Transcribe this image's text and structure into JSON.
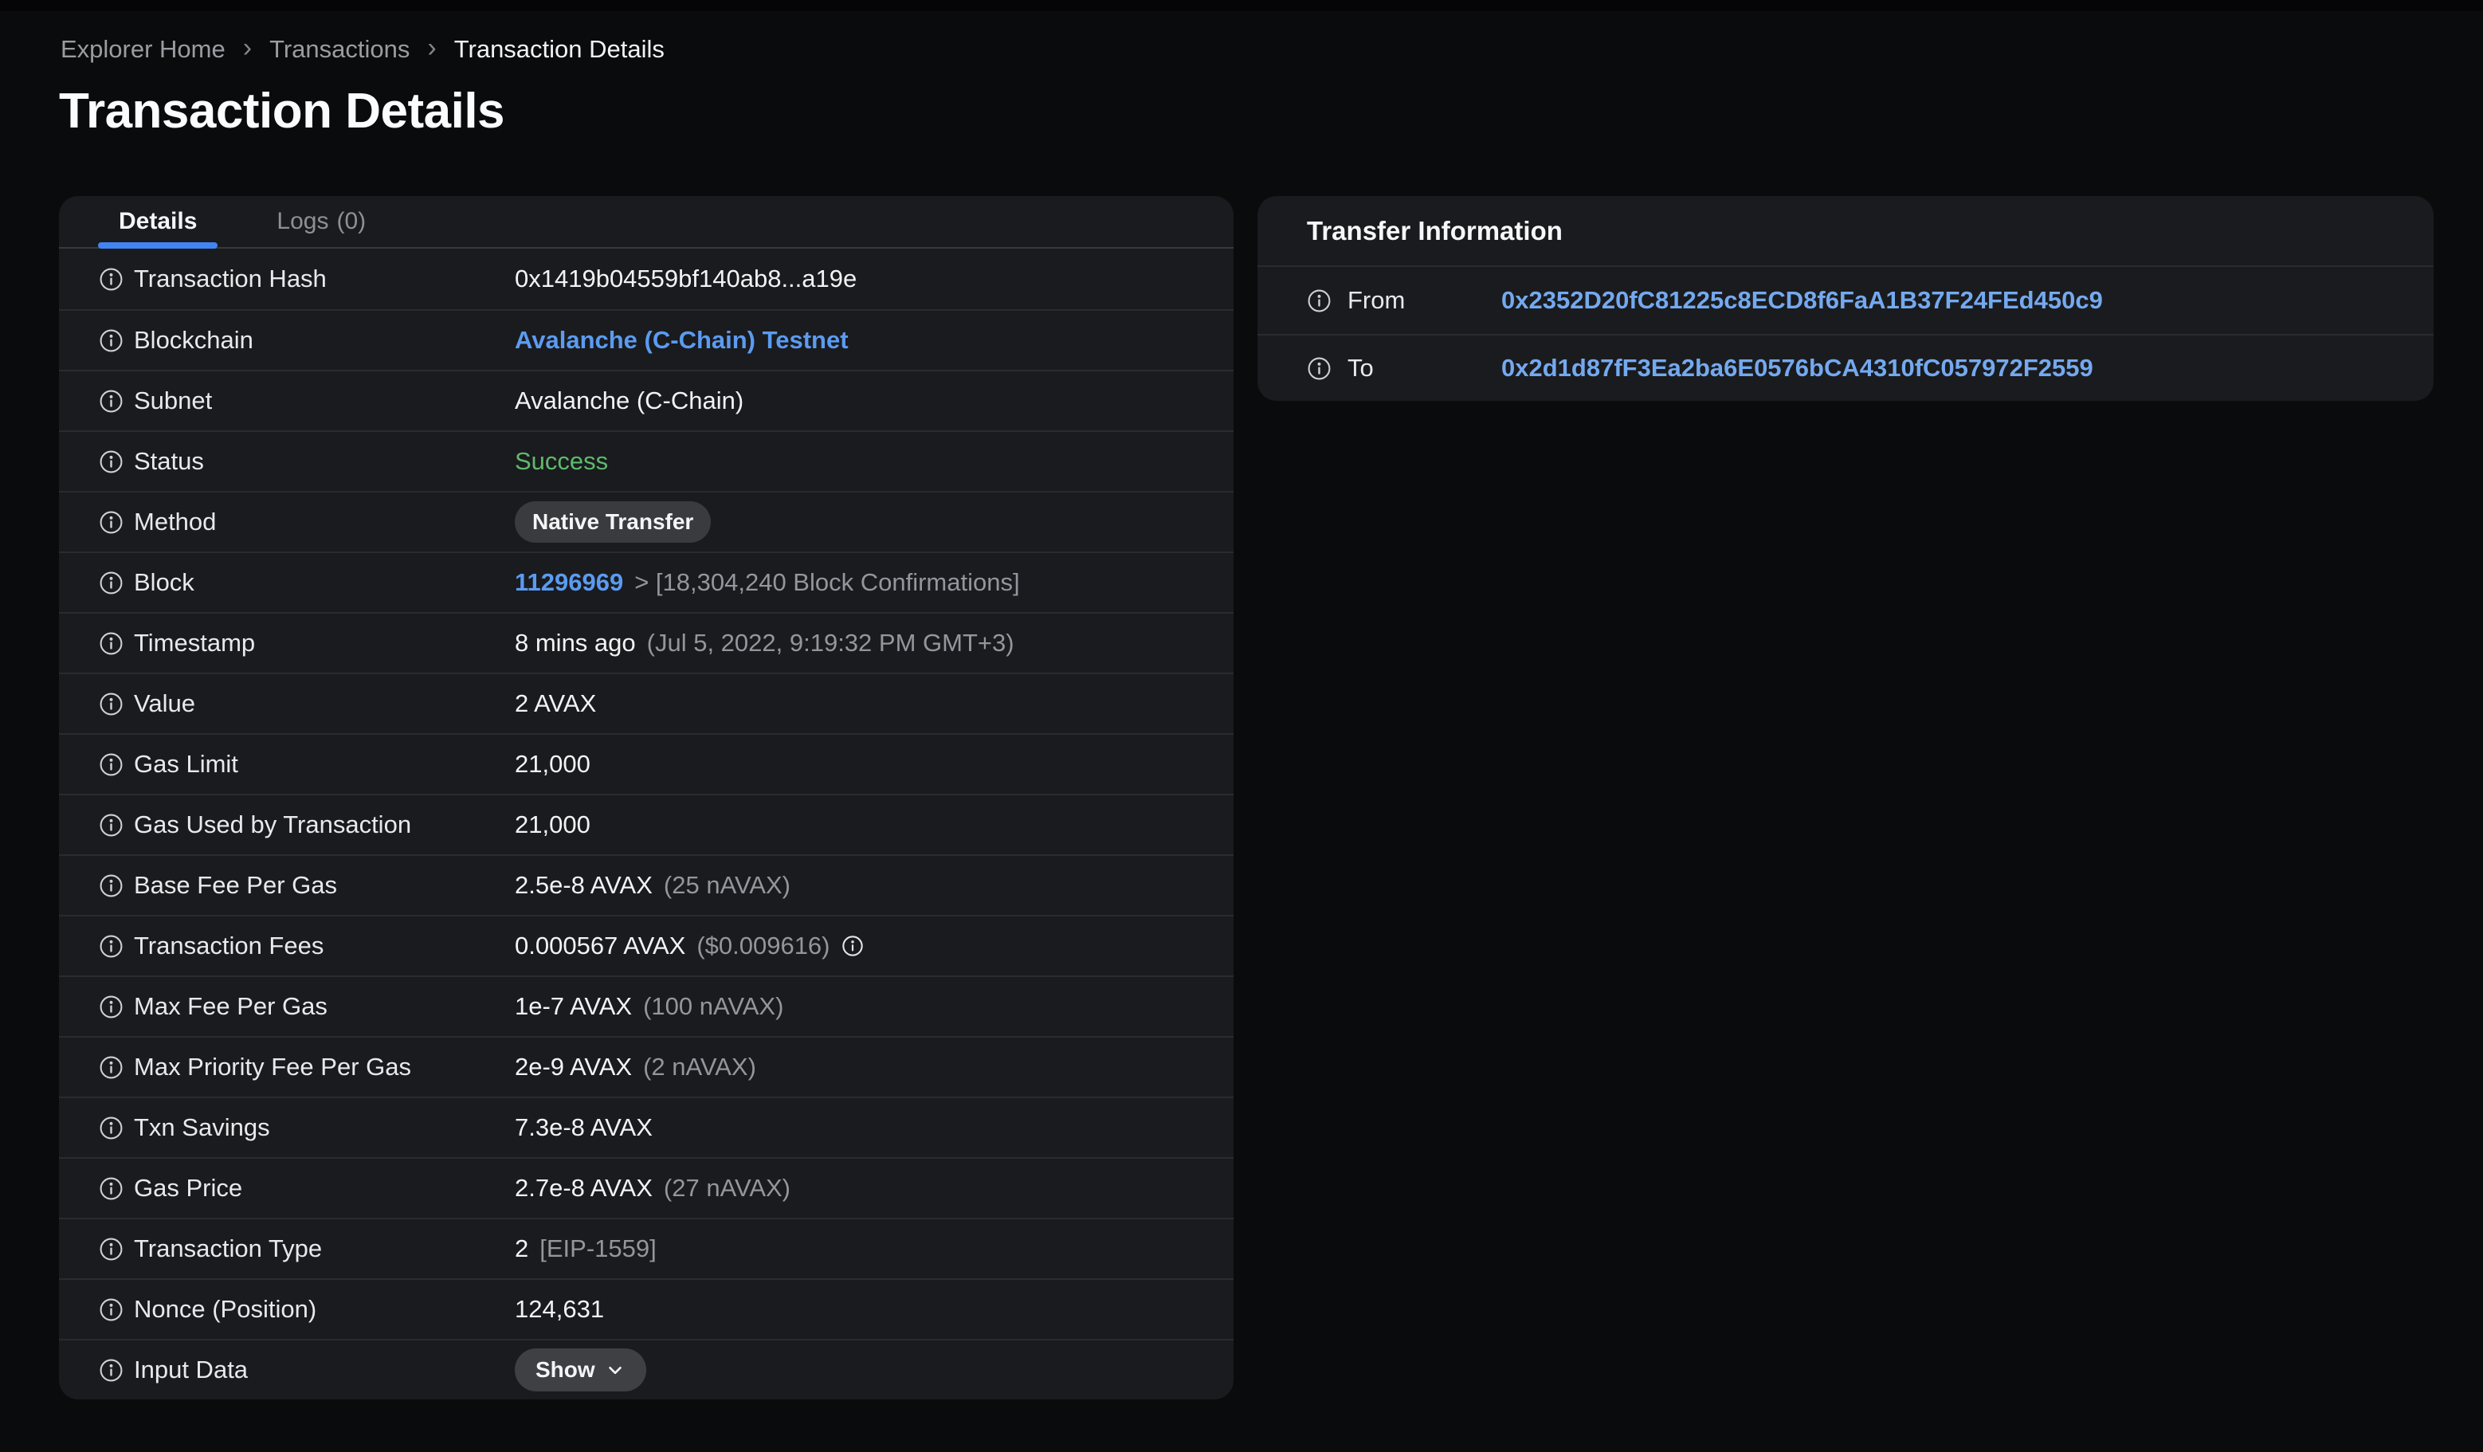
{
  "colors": {
    "accent_blue": "#4285f2",
    "link_blue": "#5b9bf1",
    "address_blue": "#74a9ef",
    "success_green": "#5fba6c",
    "card_background": "#1a1b1e",
    "page_background": "#0a0b0d"
  },
  "breadcrumb": {
    "separator": "›",
    "items": [
      {
        "label": "Explorer Home"
      },
      {
        "label": "Transactions"
      },
      {
        "label": "Transaction Details"
      }
    ]
  },
  "page": {
    "title": "Transaction Details"
  },
  "details_card": {
    "tabs": [
      {
        "label": "Details"
      },
      {
        "label": "Logs",
        "count": "(0)"
      }
    ],
    "rows": [
      {
        "label": "Transaction Hash",
        "main": "0x1419b04559bf140ab8...a19e"
      },
      {
        "label": "Blockchain",
        "link": "Avalanche (C-Chain) Testnet"
      },
      {
        "label": "Subnet",
        "main": "Avalanche (C-Chain)"
      },
      {
        "label": "Status",
        "status": "Success"
      },
      {
        "label": "Method",
        "badge": "Native Transfer"
      },
      {
        "label": "Block",
        "link": "11296969",
        "suffix": "> [18,304,240 Block Confirmations]"
      },
      {
        "label": "Timestamp",
        "main": "8 mins ago",
        "suffix": "(Jul 5, 2022, 9:19:32 PM GMT+3)"
      },
      {
        "label": "Value",
        "main": "2 AVAX"
      },
      {
        "label": "Gas Limit",
        "main": "21,000"
      },
      {
        "label": "Gas Used by Transaction",
        "main": "21,000"
      },
      {
        "label": "Base Fee Per Gas",
        "main": "2.5e-8 AVAX",
        "suffix": "(25 nAVAX)"
      },
      {
        "label": "Transaction Fees",
        "main": "0.000567 AVAX",
        "suffix": "($0.009616)"
      },
      {
        "label": "Max Fee Per Gas",
        "main": "1e-7 AVAX",
        "suffix": "(100 nAVAX)"
      },
      {
        "label": "Max Priority Fee Per Gas",
        "main": "2e-9 AVAX",
        "suffix": "(2 nAVAX)"
      },
      {
        "label": "Txn Savings",
        "main": "7.3e-8 AVAX"
      },
      {
        "label": "Gas Price",
        "main": "2.7e-8 AVAX",
        "suffix": "(27 nAVAX)"
      },
      {
        "label": "Transaction Type",
        "main": "2",
        "suffix": "[EIP-1559]"
      },
      {
        "label": "Nonce (Position)",
        "main": "124,631"
      },
      {
        "label": "Input Data",
        "button": "Show"
      }
    ]
  },
  "transfer_card": {
    "title": "Transfer Information",
    "rows": [
      {
        "label": "From",
        "address": "0x2352D20fC81225c8ECD8f6FaA1B37F24FEd450c9"
      },
      {
        "label": "To",
        "address": "0x2d1d87fF3Ea2ba6E0576bCA4310fC057972F2559"
      }
    ]
  }
}
